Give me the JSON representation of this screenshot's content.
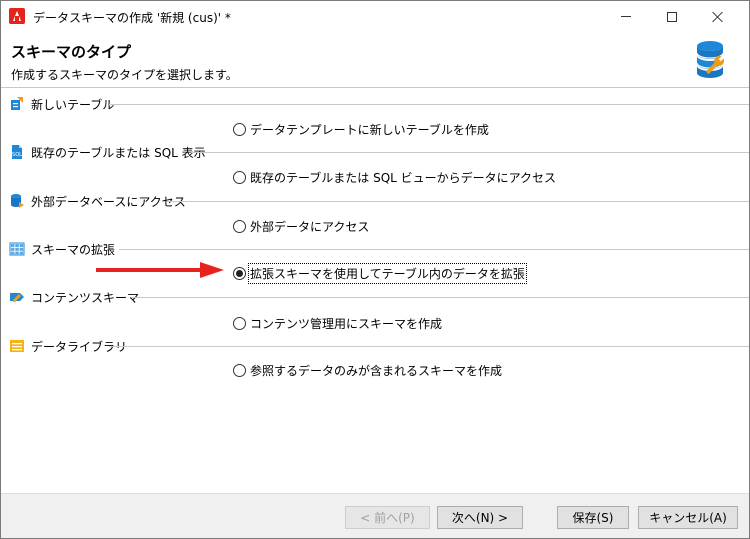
{
  "window": {
    "title": "データスキーマの作成 '新規 (cus)' *"
  },
  "header": {
    "title": "スキーマのタイプ",
    "subtitle": "作成するスキーマのタイプを選択します。",
    "icon": "database-wrench-icon"
  },
  "sections": [
    {
      "label": "新しいテーブル",
      "icon": "new-table-icon",
      "option": "データテンプレートに新しいテーブルを作成",
      "checked": false
    },
    {
      "label": "既存のテーブルまたは SQL 表示",
      "icon": "sql-icon",
      "option": "既存のテーブルまたは SQL ビューからデータにアクセス",
      "checked": false
    },
    {
      "label": "外部データベースにアクセス",
      "icon": "external-database-icon",
      "option": "外部データにアクセス",
      "checked": false
    },
    {
      "label": "スキーマの拡張",
      "icon": "grid-icon",
      "option": "拡張スキーマを使用してテーブル内のデータを拡張",
      "checked": true
    },
    {
      "label": "コンテンツスキーマ",
      "icon": "content-icon",
      "option": "コンテンツ管理用にスキーマを作成",
      "checked": false
    },
    {
      "label": "データライブラリ",
      "icon": "library-icon",
      "option": "参照するデータのみが含まれるスキーマを作成",
      "checked": false
    }
  ],
  "footer": {
    "prev": "< 前へ(P)",
    "next": "次へ(N) >",
    "save": "保存(S)",
    "cancel": "キャンセル(A)"
  },
  "colors": {
    "arrow": "#e8231f",
    "accent_blue": "#1e88d8",
    "icon_orange": "#f39c12"
  }
}
